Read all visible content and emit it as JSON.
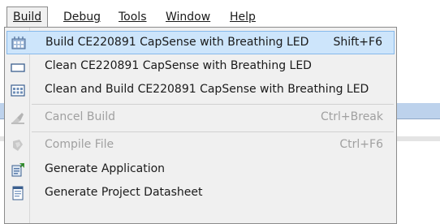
{
  "menubar": {
    "items": [
      {
        "label": "Build"
      },
      {
        "label": "Debug"
      },
      {
        "label": "Tools"
      },
      {
        "label": "Window"
      },
      {
        "label": "Help"
      }
    ]
  },
  "build_menu": {
    "items": [
      {
        "label": "Build CE220891 CapSense with Breathing LED",
        "shortcut": "Shift+F6",
        "icon": "build-icon",
        "state": "highlighted"
      },
      {
        "label": "Clean CE220891 CapSense with Breathing LED",
        "shortcut": "",
        "icon": "clean-icon",
        "state": "enabled"
      },
      {
        "label": "Clean and Build CE220891 CapSense with Breathing LED",
        "shortcut": "",
        "icon": "clean-build-icon",
        "state": "enabled"
      },
      {
        "label": "Cancel Build",
        "shortcut": "Ctrl+Break",
        "icon": "cancel-build-icon",
        "state": "disabled"
      },
      {
        "label": "Compile File",
        "shortcut": "Ctrl+F6",
        "icon": "compile-file-icon",
        "state": "disabled"
      },
      {
        "label": "Generate Application",
        "shortcut": "",
        "icon": "generate-application-icon",
        "state": "enabled"
      },
      {
        "label": "Generate Project Datasheet",
        "shortcut": "",
        "icon": "datasheet-icon",
        "state": "enabled"
      }
    ]
  },
  "colors": {
    "highlight_bg": "#cde5fb",
    "highlight_border": "#86b9eb",
    "disabled_text": "#a0a0a0",
    "menu_bg": "#f0f0f0"
  }
}
